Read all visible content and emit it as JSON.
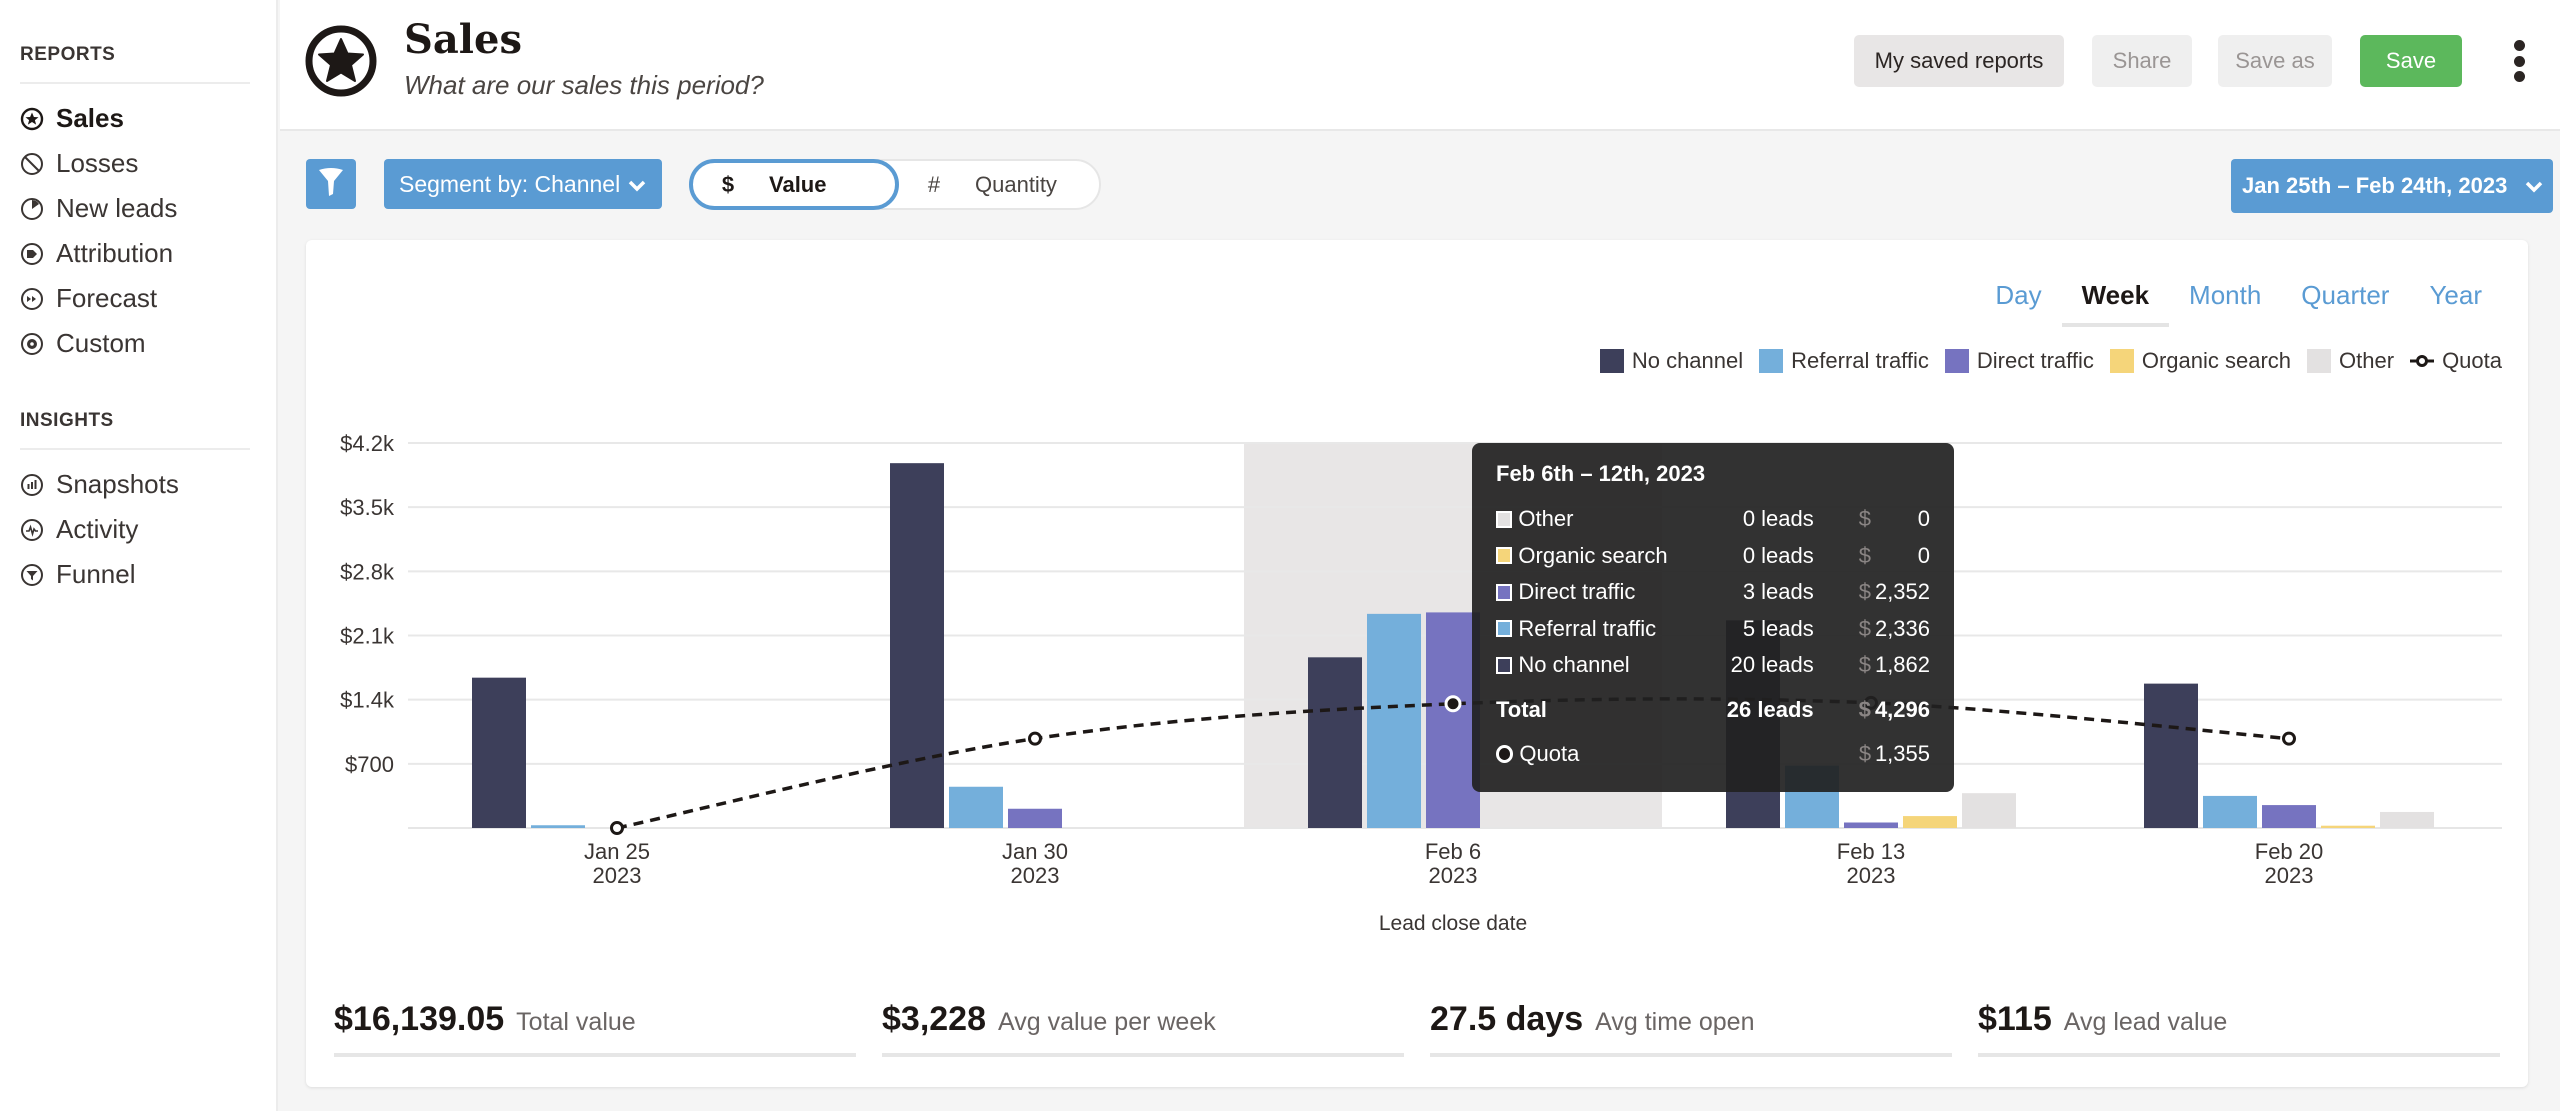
{
  "sidebar": {
    "sections": [
      {
        "title": "REPORTS",
        "items": [
          {
            "label": "Sales",
            "icon": "star-circle-icon",
            "active": true
          },
          {
            "label": "Losses",
            "icon": "prohibited-icon"
          },
          {
            "label": "New leads",
            "icon": "pie-circle-icon"
          },
          {
            "label": "Attribution",
            "icon": "tag-circle-icon"
          },
          {
            "label": "Forecast",
            "icon": "fast-forward-circle-icon"
          },
          {
            "label": "Custom",
            "icon": "gear-circle-icon"
          }
        ]
      },
      {
        "title": "INSIGHTS",
        "items": [
          {
            "label": "Snapshots",
            "icon": "bar-chart-circle-icon"
          },
          {
            "label": "Activity",
            "icon": "pulse-circle-icon"
          },
          {
            "label": "Funnel",
            "icon": "funnel-circle-icon"
          }
        ]
      }
    ]
  },
  "header": {
    "title": "Sales",
    "subtitle": "What are our sales this period?",
    "buttons": {
      "saved_reports": "My saved reports",
      "share": "Share",
      "save_as": "Save as",
      "save": "Save"
    }
  },
  "toolbar": {
    "segment_label": "Segment by: Channel",
    "toggle": [
      {
        "symbol": "$",
        "label": "Value",
        "active": true
      },
      {
        "symbol": "#",
        "label": "Quantity",
        "active": false
      }
    ],
    "date_range": "Jan 25th – Feb 24th, 2023"
  },
  "period_tabs": [
    {
      "label": "Day"
    },
    {
      "label": "Week",
      "active": true
    },
    {
      "label": "Month"
    },
    {
      "label": "Quarter"
    },
    {
      "label": "Year"
    }
  ],
  "colors": {
    "no_channel": "#3d3f5a",
    "referral": "#74afdb",
    "direct": "#7673c0",
    "organic": "#f5d57a",
    "other": "#e3e1e1",
    "quota": "#1d1816",
    "accent": "#5a9bd3",
    "save": "#5cb85c"
  },
  "chart_data": {
    "type": "bar",
    "title": "",
    "xlabel": "Lead close date",
    "ylabel": "",
    "ylim": [
      0,
      4200
    ],
    "yticks": [
      700,
      1400,
      2100,
      2800,
      3500,
      4200
    ],
    "ytick_labels": [
      "$700",
      "$1.4k",
      "$2.1k",
      "$2.8k",
      "$3.5k",
      "$4.2k"
    ],
    "grid": true,
    "legend_position": "top-right",
    "categories": [
      "Jan 25",
      "Jan 30",
      "Feb 6",
      "Feb 13",
      "Feb 20"
    ],
    "category_years": [
      "2023",
      "2023",
      "2023",
      "2023",
      "2023"
    ],
    "series": [
      {
        "name": "No channel",
        "key": "no_channel",
        "values": [
          1640,
          3980,
          1862,
          2265,
          1575
        ]
      },
      {
        "name": "Referral traffic",
        "key": "referral",
        "values": [
          30,
          450,
          2336,
          680,
          350
        ]
      },
      {
        "name": "Direct traffic",
        "key": "direct",
        "values": [
          0,
          210,
          2352,
          60,
          250
        ]
      },
      {
        "name": "Organic search",
        "key": "organic",
        "values": [
          0,
          0,
          0,
          130,
          25
        ]
      },
      {
        "name": "Other",
        "key": "other",
        "values": [
          0,
          0,
          0,
          380,
          175
        ]
      }
    ],
    "line_series": {
      "name": "Quota",
      "type": "line",
      "style": "dashed",
      "values": [
        0,
        975,
        1355,
        1365,
        975
      ]
    },
    "highlighted_category": "Feb 6"
  },
  "tooltip": {
    "title": "Feb 6th – 12th, 2023",
    "rows": [
      {
        "name": "Other",
        "key": "other",
        "leads": "0 leads",
        "currency": "$",
        "value": "0"
      },
      {
        "name": "Organic search",
        "key": "organic",
        "leads": "0 leads",
        "currency": "$",
        "value": "0"
      },
      {
        "name": "Direct traffic",
        "key": "direct",
        "leads": "3 leads",
        "currency": "$",
        "value": "2,352"
      },
      {
        "name": "Referral traffic",
        "key": "referral",
        "leads": "5 leads",
        "currency": "$",
        "value": "2,336"
      },
      {
        "name": "No channel",
        "key": "no_channel",
        "leads": "20 leads",
        "currency": "$",
        "value": "1,862"
      }
    ],
    "total": {
      "name": "Total",
      "leads": "26 leads",
      "currency": "$",
      "value": "4,296"
    },
    "quota": {
      "name": "Quota",
      "currency": "$",
      "value": "1,355"
    }
  },
  "kpis": [
    {
      "value": "$16,139.05",
      "label": "Total value"
    },
    {
      "value": "$3,228",
      "label": "Avg value per week"
    },
    {
      "value": "27.5 days",
      "label": "Avg time open"
    },
    {
      "value": "$115",
      "label": "Avg lead value"
    }
  ]
}
